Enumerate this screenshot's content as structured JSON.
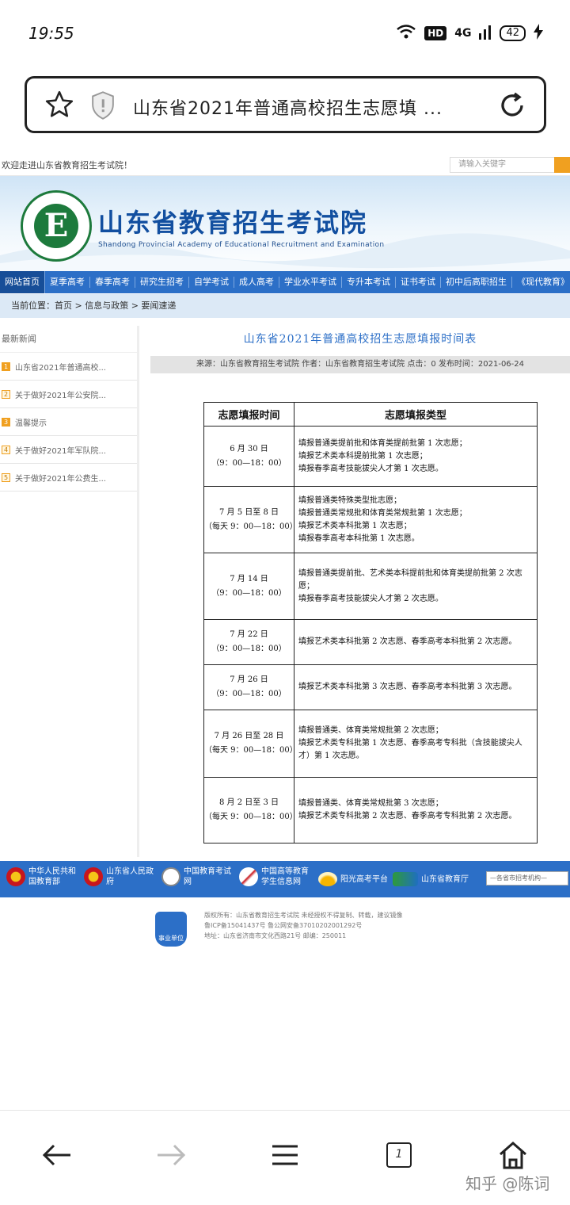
{
  "status_bar": {
    "time": "19:55",
    "network": "4G",
    "hd": "HD",
    "battery": "42",
    "icons": [
      "wifi-icon",
      "signal-icon",
      "charging-icon"
    ]
  },
  "address_bar": {
    "title": "山东省2021年普通高校招生志愿填 ...",
    "icons": [
      "star-icon",
      "shield-icon",
      "refresh-icon"
    ]
  },
  "site": {
    "welcome": "欢迎走进山东省教育招生考试院！",
    "search_placeholder": "请输入关键字",
    "name_cn": "山东省教育招生考试院",
    "name_en": "Shandong Provincial Academy of Educational Recruitment and Examination",
    "logo_letter": "E"
  },
  "nav": {
    "items": [
      "网站首页",
      "夏季高考",
      "春季高考",
      "研究生招考",
      "自学考试",
      "成人高考",
      "学业水平考试",
      "专升本考试",
      "证书考试",
      "初中后高职招生",
      "《现代教育》"
    ]
  },
  "breadcrumb": "当前位置：首页 > 信息与政策 > 要闻速递",
  "sidebar": {
    "title": "最新新闻",
    "items": [
      {
        "num": "1",
        "text": "山东省2021年普通高校..."
      },
      {
        "num": "2",
        "text": "关于做好2021年公安院..."
      },
      {
        "num": "3",
        "text": "温馨提示"
      },
      {
        "num": "4",
        "text": "关于做好2021年军队院..."
      },
      {
        "num": "5",
        "text": "关于做好2021年公费生..."
      }
    ]
  },
  "article": {
    "title": "山东省2021年普通高校招生志愿填报时间表",
    "meta": "来源：山东省教育招生考试院 作者：山东省教育招生考试院 点击：0 发布时间：2021-06-24",
    "table_headers": [
      "志愿填报时间",
      "志愿填报类型"
    ],
    "rows": [
      {
        "date": "6 月 30 日",
        "hours": "（9：00—18：00）",
        "types": [
          "填报普通类提前批和体育类提前批第 1 次志愿；",
          "填报艺术类本科提前批第 1 次志愿；",
          "填报春季高考技能拔尖人才第 1 次志愿。"
        ]
      },
      {
        "date": "7 月 5 日至 8 日",
        "hours": "（每天 9：00—18：00）",
        "types": [
          "填报普通类特殊类型批志愿；",
          "填报普通类常规批和体育类常规批第 1 次志愿；",
          "填报艺术类本科批第 1 次志愿；",
          "填报春季高考本科批第 1 次志愿。"
        ]
      },
      {
        "date": "7 月 14 日",
        "hours": "（9：00—18：00）",
        "types": [
          "填报普通类提前批、艺术类本科提前批和体育类提前批第 2 次志愿；",
          "填报春季高考技能拔尖人才第 2 次志愿。"
        ]
      },
      {
        "date": "7 月 22 日",
        "hours": "（9：00—18：00）",
        "types": [
          "填报艺术类本科批第 2 次志愿、春季高考本科批第 2 次志愿。"
        ]
      },
      {
        "date": "7 月 26 日",
        "hours": "（9：00—18：00）",
        "types": [
          "填报艺术类本科批第 3 次志愿、春季高考本科批第 3 次志愿。"
        ]
      },
      {
        "date": "7 月 26 日至 28 日",
        "hours": "（每天 9：00—18：00）",
        "types": [
          "填报普通类、体育类常规批第 2 次志愿；",
          "填报艺术类专科批第 1 次志愿、春季高考专科批（含技能拔尖人才）第 1 次志愿。"
        ]
      },
      {
        "date": "8 月 2 日至 3 日",
        "hours": "（每天 9：00—18：00）",
        "types": [
          "填报普通类、体育类常规批第 3 次志愿；",
          "填报艺术类专科批第 2 次志愿、春季高考专科批第 2 次志愿。"
        ]
      }
    ]
  },
  "footer": {
    "links": [
      {
        "label1": "中华人民共和",
        "label2": "国教育部"
      },
      {
        "label1": "山东省人民政",
        "label2": "府"
      },
      {
        "label1": "中国教育考试",
        "label2": "网"
      },
      {
        "label1": "中国高等教育",
        "label2": "学生信息网"
      },
      {
        "label1": "阳光高考平台",
        "label2": ""
      },
      {
        "label1": "山东省教育厅",
        "label2": ""
      }
    ],
    "select_label": "—各省市招考机构—",
    "badge": "事业单位",
    "copyright_lines": [
      "版权所有：山东省教育招生考试院 未经授权不得复制、转载，建议镜像",
      "鲁ICP备15041437号        鲁公网安备37010202001292号",
      "地址：山东省济南市文化西路21号 邮编：250011"
    ]
  },
  "bottom_nav": {
    "tab_count": "1",
    "watermark": "知乎 @陈词",
    "icons": [
      "back-arrow-icon",
      "forward-arrow-icon",
      "menu-icon",
      "tabs-icon",
      "home-icon"
    ]
  }
}
